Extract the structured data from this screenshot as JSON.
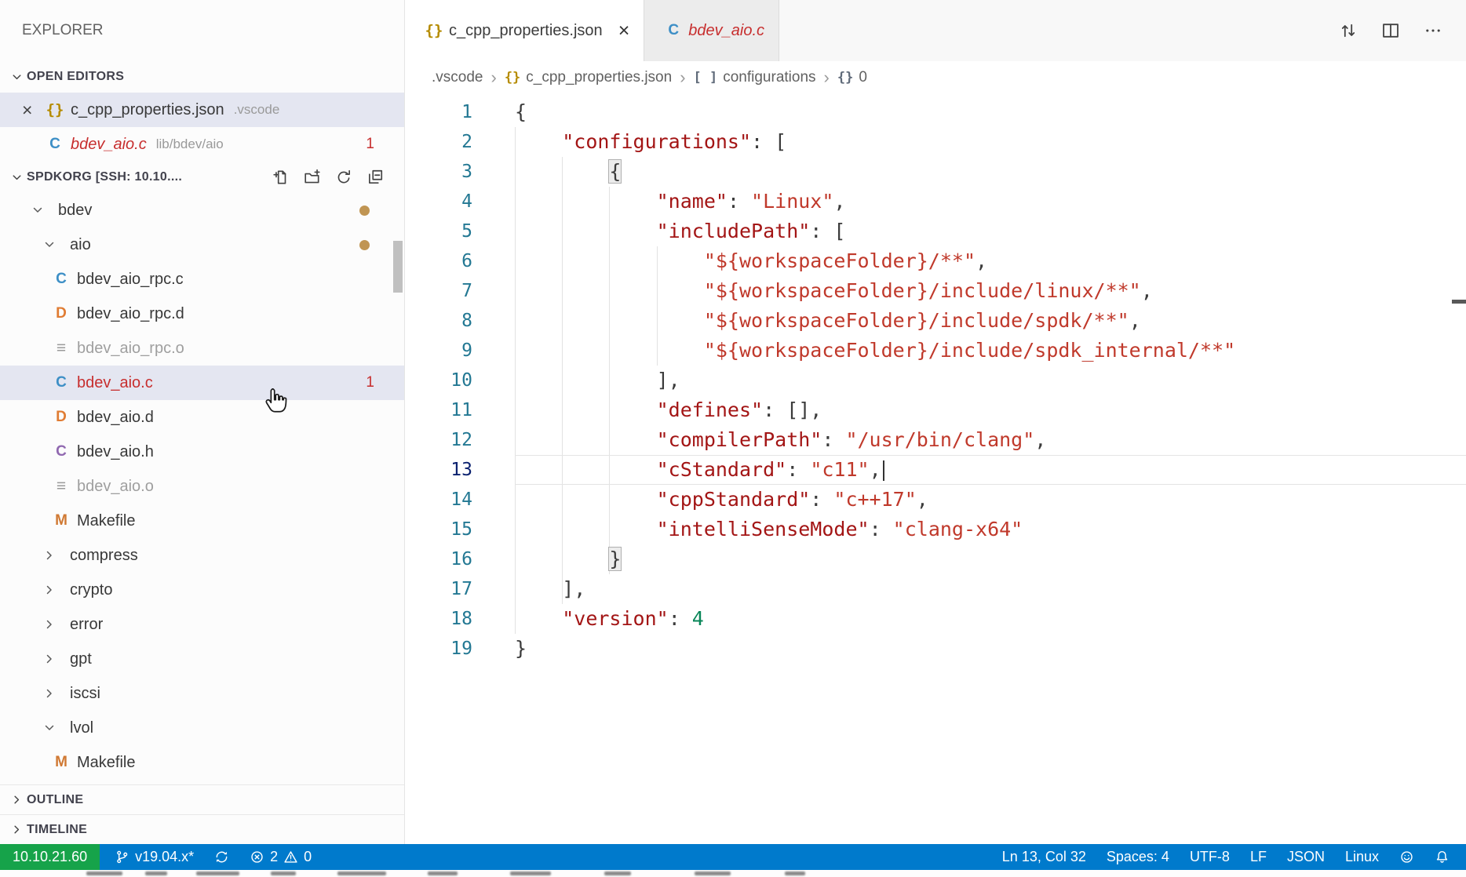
{
  "colors": {
    "statusbar_bg": "#007acc",
    "remote_bg": "#16a34a",
    "error_red": "#c72e2e",
    "selection_bg": "#e4e6f1",
    "json_key": "#a31515",
    "json_string": "#c0392b",
    "json_number": "#098658",
    "line_number": "#237893",
    "modified_dot": "#c09553"
  },
  "sidebar": {
    "title": "EXPLORER",
    "open_editors": {
      "header": "OPEN EDITORS",
      "items": [
        {
          "icon": "json",
          "name": "c_cpp_properties.json",
          "detail": ".vscode",
          "selected": true,
          "closable": true
        },
        {
          "icon": "c",
          "name": "bdev_aio.c",
          "detail": "lib/bdev/aio",
          "italic": true,
          "error": true,
          "badge": "1"
        }
      ]
    },
    "tree": {
      "header": "SPDKORG [SSH: 10.10....",
      "actions": [
        "new-file",
        "new-folder",
        "refresh",
        "collapse-all"
      ],
      "items": [
        {
          "label": "bdev",
          "kind": "folder",
          "expanded": true,
          "depth": 0,
          "modified": true
        },
        {
          "label": "aio",
          "kind": "folder",
          "expanded": true,
          "depth": 1,
          "modified": true
        },
        {
          "label": "bdev_aio_rpc.c",
          "kind": "file",
          "icon": "c",
          "depth": 2
        },
        {
          "label": "bdev_aio_rpc.d",
          "kind": "file",
          "icon": "d",
          "depth": 2
        },
        {
          "label": "bdev_aio_rpc.o",
          "kind": "file",
          "icon": "o",
          "depth": 2,
          "dimmed": true
        },
        {
          "label": "bdev_aio.c",
          "kind": "file",
          "icon": "c",
          "depth": 2,
          "selected": true,
          "error": true,
          "badge": "1"
        },
        {
          "label": "bdev_aio.d",
          "kind": "file",
          "icon": "d",
          "depth": 2
        },
        {
          "label": "bdev_aio.h",
          "kind": "file",
          "icon": "h",
          "depth": 2
        },
        {
          "label": "bdev_aio.o",
          "kind": "file",
          "icon": "o",
          "depth": 2,
          "dimmed": true
        },
        {
          "label": "Makefile",
          "kind": "file",
          "icon": "makefile",
          "depth": 2
        },
        {
          "label": "compress",
          "kind": "folder",
          "expanded": false,
          "depth": 1
        },
        {
          "label": "crypto",
          "kind": "folder",
          "expanded": false,
          "depth": 1
        },
        {
          "label": "error",
          "kind": "folder",
          "expanded": false,
          "depth": 1
        },
        {
          "label": "gpt",
          "kind": "folder",
          "expanded": false,
          "depth": 1
        },
        {
          "label": "iscsi",
          "kind": "folder",
          "expanded": false,
          "depth": 1
        },
        {
          "label": "lvol",
          "kind": "folder",
          "expanded": true,
          "depth": 1
        },
        {
          "label": "Makefile",
          "kind": "file",
          "icon": "makefile",
          "depth": 2
        }
      ]
    },
    "outline": {
      "header": "OUTLINE"
    },
    "timeline": {
      "header": "TIMELINE"
    }
  },
  "tabs": [
    {
      "icon": "json",
      "label": "c_cpp_properties.json",
      "active": true,
      "closable": true
    },
    {
      "icon": "c",
      "label": "bdev_aio.c",
      "italic": true,
      "error": true
    }
  ],
  "editor_actions": [
    "open-changes",
    "split-editor",
    "more-actions"
  ],
  "breadcrumb": [
    {
      "label": ".vscode"
    },
    {
      "label": "c_cpp_properties.json",
      "icon": "json"
    },
    {
      "label": "configurations",
      "icon": "array"
    },
    {
      "label": "0",
      "icon": "object"
    }
  ],
  "editor": {
    "language": "json",
    "current_line": 13,
    "lines": [
      {
        "n": 1,
        "segs": [
          [
            "{",
            "pun"
          ]
        ]
      },
      {
        "n": 2,
        "segs": [
          [
            "    ",
            "ws"
          ],
          [
            "\"configurations\"",
            "key"
          ],
          [
            ": ",
            "pun"
          ],
          [
            "[",
            "pun"
          ]
        ]
      },
      {
        "n": 3,
        "segs": [
          [
            "        ",
            "ws"
          ],
          [
            "{",
            "pun box"
          ]
        ]
      },
      {
        "n": 4,
        "segs": [
          [
            "            ",
            "ws"
          ],
          [
            "\"name\"",
            "key"
          ],
          [
            ": ",
            "pun"
          ],
          [
            "\"Linux\"",
            "str"
          ],
          [
            ",",
            "pun"
          ]
        ]
      },
      {
        "n": 5,
        "segs": [
          [
            "            ",
            "ws"
          ],
          [
            "\"includePath\"",
            "key"
          ],
          [
            ": ",
            "pun"
          ],
          [
            "[",
            "pun"
          ]
        ]
      },
      {
        "n": 6,
        "segs": [
          [
            "                ",
            "ws"
          ],
          [
            "\"${workspaceFolder}/**\"",
            "str"
          ],
          [
            ",",
            "pun"
          ]
        ]
      },
      {
        "n": 7,
        "segs": [
          [
            "                ",
            "ws"
          ],
          [
            "\"${workspaceFolder}/include/linux/**\"",
            "str"
          ],
          [
            ",",
            "pun"
          ]
        ]
      },
      {
        "n": 8,
        "segs": [
          [
            "                ",
            "ws"
          ],
          [
            "\"${workspaceFolder}/include/spdk/**\"",
            "str"
          ],
          [
            ",",
            "pun"
          ]
        ]
      },
      {
        "n": 9,
        "segs": [
          [
            "                ",
            "ws"
          ],
          [
            "\"${workspaceFolder}/include/spdk_internal/**\"",
            "str"
          ]
        ]
      },
      {
        "n": 10,
        "segs": [
          [
            "            ",
            "ws"
          ],
          [
            "],",
            "pun"
          ]
        ]
      },
      {
        "n": 11,
        "segs": [
          [
            "            ",
            "ws"
          ],
          [
            "\"defines\"",
            "key"
          ],
          [
            ": ",
            "pun"
          ],
          [
            "[],",
            "pun"
          ]
        ]
      },
      {
        "n": 12,
        "segs": [
          [
            "            ",
            "ws"
          ],
          [
            "\"compilerPath\"",
            "key"
          ],
          [
            ": ",
            "pun"
          ],
          [
            "\"/usr/bin/clang\"",
            "str"
          ],
          [
            ",",
            "pun"
          ]
        ]
      },
      {
        "n": 13,
        "segs": [
          [
            "            ",
            "ws"
          ],
          [
            "\"cStandard\"",
            "key"
          ],
          [
            ": ",
            "pun"
          ],
          [
            "\"c11\"",
            "str"
          ],
          [
            ",",
            "pun"
          ]
        ]
      },
      {
        "n": 14,
        "segs": [
          [
            "            ",
            "ws"
          ],
          [
            "\"cppStandard\"",
            "key"
          ],
          [
            ": ",
            "pun"
          ],
          [
            "\"c++17\"",
            "str"
          ],
          [
            ",",
            "pun"
          ]
        ]
      },
      {
        "n": 15,
        "segs": [
          [
            "            ",
            "ws"
          ],
          [
            "\"intelliSenseMode\"",
            "key"
          ],
          [
            ": ",
            "pun"
          ],
          [
            "\"clang-x64\"",
            "str"
          ]
        ]
      },
      {
        "n": 16,
        "segs": [
          [
            "        ",
            "ws"
          ],
          [
            "}",
            "pun box"
          ]
        ]
      },
      {
        "n": 17,
        "segs": [
          [
            "    ",
            "ws"
          ],
          [
            "],",
            "pun"
          ]
        ]
      },
      {
        "n": 18,
        "segs": [
          [
            "    ",
            "ws"
          ],
          [
            "\"version\"",
            "key"
          ],
          [
            ": ",
            "pun"
          ],
          [
            "4",
            "num"
          ]
        ]
      },
      {
        "n": 19,
        "segs": [
          [
            "}",
            "pun"
          ]
        ]
      }
    ],
    "guides": [
      {
        "col": 0,
        "from": 2,
        "to": 18
      },
      {
        "col": 4,
        "from": 3,
        "to": 17
      },
      {
        "col": 8,
        "from": 4,
        "to": 16
      },
      {
        "col": 12,
        "from": 6,
        "to": 9
      }
    ]
  },
  "status_bar": {
    "left": [
      {
        "name": "remote-host",
        "text": "10.10.21.60",
        "style": "remote"
      },
      {
        "name": "git-branch",
        "icon": "branch",
        "text": "v19.04.x*"
      },
      {
        "name": "sync",
        "icon": "sync"
      },
      {
        "name": "problems",
        "errors": "2",
        "warnings": "0"
      }
    ],
    "right": [
      {
        "name": "cursor-position",
        "text": "Ln 13, Col 32"
      },
      {
        "name": "indentation",
        "text": "Spaces: 4"
      },
      {
        "name": "encoding",
        "text": "UTF-8"
      },
      {
        "name": "eol",
        "text": "LF"
      },
      {
        "name": "language-mode",
        "text": "JSON"
      },
      {
        "name": "remote-os",
        "text": "Linux"
      },
      {
        "name": "feedback",
        "icon": "smiley"
      },
      {
        "name": "notifications",
        "icon": "bell"
      }
    ]
  }
}
